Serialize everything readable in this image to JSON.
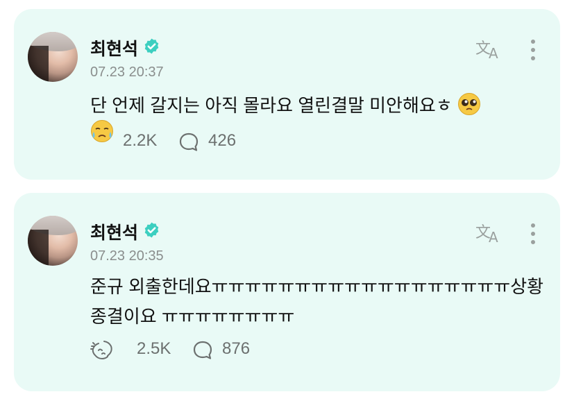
{
  "posts": [
    {
      "author": "최현석",
      "timestamp": "07.23 20:37",
      "text_line1": "단 언제 갈지는 아직 몰라요 열린결말 미안해요ㅎ",
      "text_line2": "",
      "emoji_inline": "pleading-face",
      "emoji_reaction": "crying-face",
      "likes": "2.2K",
      "comments": "426"
    },
    {
      "author": "최현석",
      "timestamp": "07.23 20:35",
      "text_line1": "준규 외출한데요ㅠㅠㅠㅠㅠㅠㅠㅠㅠㅠㅠㅠㅠㅠㅠㅠㅠㅠ상황",
      "text_line2": "종결이요 ㅠㅠㅠㅠㅠㅠㅠㅠ",
      "likes": "2.5K",
      "comments": "876"
    }
  ],
  "colors": {
    "card_bg": "#e9faf6",
    "verified": "#3ccfc0",
    "muted": "#8a8e8d"
  },
  "icons": [
    "verified-badge-icon",
    "translate-icon",
    "more-vertical-icon",
    "reaction-icon",
    "comment-icon"
  ]
}
